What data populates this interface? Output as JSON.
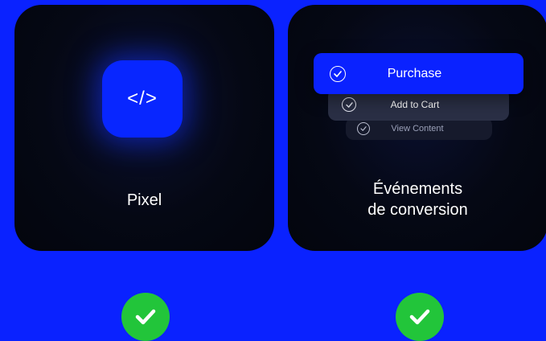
{
  "pixel_card": {
    "icon_glyph": "</>",
    "icon": "code-icon",
    "label": "Pixel"
  },
  "events_card": {
    "label_line1": "Événements",
    "label_line2": "de conversion",
    "events": [
      {
        "label": "Purchase",
        "icon": "check-circle-icon"
      },
      {
        "label": "Add to Cart",
        "icon": "check-circle-icon"
      },
      {
        "label": "View Content",
        "icon": "check-circle-icon"
      }
    ]
  },
  "status": {
    "pixel_check_icon": "check-icon",
    "events_check_icon": "check-icon"
  },
  "colors": {
    "background": "#0a22ff",
    "card": "#050814",
    "accent": "#0826ff",
    "success": "#22c53a"
  }
}
